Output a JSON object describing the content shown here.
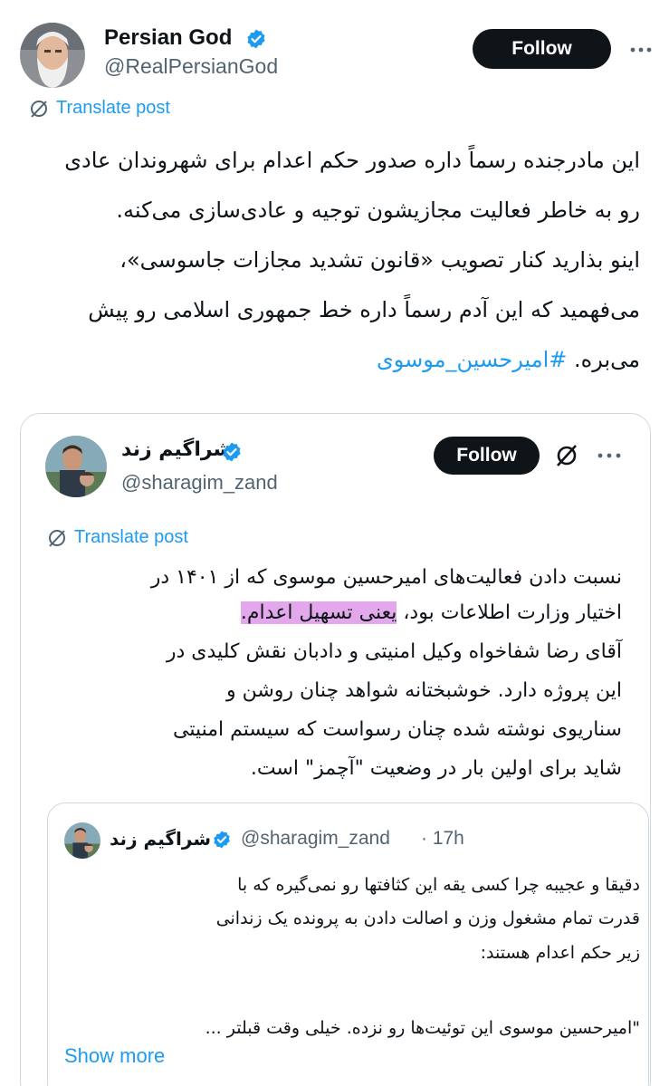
{
  "main_post": {
    "author_name": "Persian God",
    "author_handle": "@RealPersianGod",
    "follow_label": "Follow",
    "translate_label": "Translate post",
    "lines": [
      "این مادرجنده رسماً داره صدور حکم اعدام برای شهروندان عادی",
      "رو به خاطر فعالیت مجازیشون توجیه و عادی‌سازی می‌کنه.",
      "اینو بذارید کنار تصویب «قانون تشدید مجازات جاسوسی»،",
      "می‌فهمید که این آدم رسماً داره خط جمهوری اسلامی رو پیش"
    ],
    "last_line_text": "می‌بره.",
    "hashtag": "#امیرحسین_موسوی"
  },
  "quoted_post": {
    "author_name": "شراگیم زند",
    "author_handle": "@sharagim_zand",
    "follow_label": "Follow",
    "translate_label": "Translate post",
    "line1": "نسبت دادن فعالیت‌های امیرحسین موسوی که از ۱۴۰۱ در",
    "line2_plain": "اختیار وزارت اطلاعات بود، ",
    "line2_highlight": "یعنی تسهیل اعدام.",
    "lines_rest": [
      "آقای رضا شفاخواه وکیل امنیتی و دادبان نقش کلیدی در",
      "این پروژه دارد. خوشبختانه شواهد چنان روشن و",
      "سناریوی نوشته شده چنان رسواست که سیستم امنیتی",
      "شاید برای اولین بار  در وضعیت \"آچمز\" است."
    ]
  },
  "nested_quote": {
    "author_name": "شراگیم زند",
    "author_handle": "@sharagim_zand",
    "time": "· 17h",
    "lines": [
      "دقیقا و عجیبه چرا کسی یقه این کثافتها رو نمی‌گیره که با",
      "قدرت تمام مشغول وزن و اصالت دادن به پرونده یک زندانی",
      "زیر حکم اعدام هستند:",
      "",
      "\"امیرحسین موسوی این توئیت‌ها رو نزده. خیلی وقت قبلتر ..."
    ],
    "show_more_label": "Show more"
  },
  "colors": {
    "accent": "#1d9bf0",
    "highlight": "#e3a8ec",
    "button_bg": "#0f1419",
    "secondary_text": "#536471",
    "border": "#cfd9de"
  },
  "icons": [
    "verified-badge-icon",
    "more-options-icon",
    "translate-globe-icon",
    "grok-icon"
  ]
}
